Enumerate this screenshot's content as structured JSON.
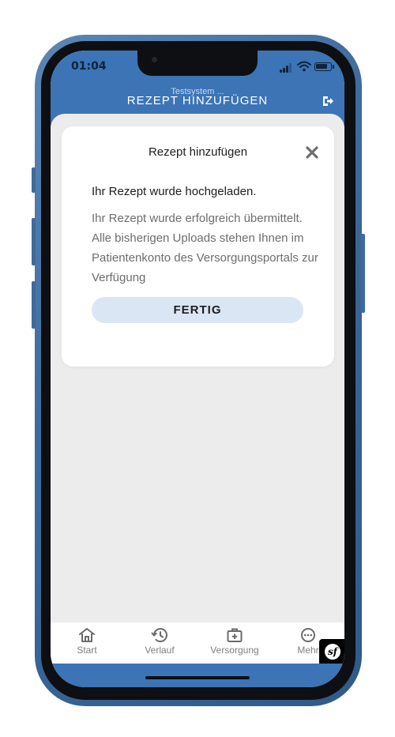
{
  "status_bar": {
    "time": "01:04"
  },
  "header": {
    "subtitle": "Testsystem ...",
    "title": "REZEPT HINZUFÜGEN",
    "logout_icon": "logout-icon"
  },
  "modal": {
    "title": "Rezept hinzufügen",
    "heading": "Ihr Rezept wurde hochgeladen.",
    "body": "Ihr Rezept wurde erfolgreich übermittelt. Alle bisherigen Uploads stehen Ihnen im Patientenkonto des Versorgungsportals zur Verfügung",
    "button_label": "FERTIG",
    "close_icon": "close-icon"
  },
  "tabs": [
    {
      "label": "Start",
      "icon": "home-icon"
    },
    {
      "label": "Verlauf",
      "icon": "history-icon"
    },
    {
      "label": "Versorgung",
      "icon": "medical-bag-icon"
    },
    {
      "label": "Mehr",
      "icon": "more-icon"
    }
  ],
  "debug_badge": {
    "text": "sf"
  },
  "colors": {
    "primary": "#3c74b6",
    "button_bg": "#dbe6f5",
    "content_bg": "#ececec",
    "phone_frame": "#3e6a9c"
  }
}
